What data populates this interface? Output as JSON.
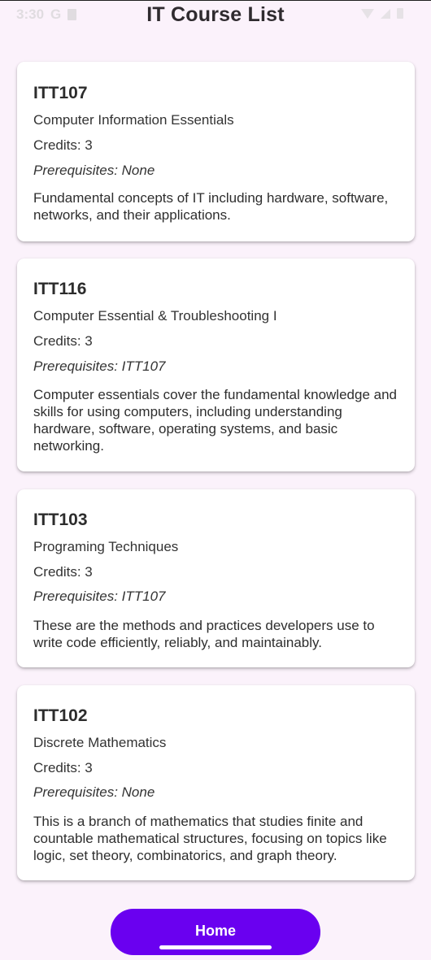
{
  "status_bar": {
    "time": "3:30",
    "indicator": "G"
  },
  "header": {
    "title": "IT Course List"
  },
  "courses": [
    {
      "code": "ITT107",
      "name": "Computer Information Essentials",
      "credits": "Credits: 3",
      "prerequisites": "Prerequisites: None",
      "description": "Fundamental concepts of IT including hardware, software, networks, and their applications."
    },
    {
      "code": "ITT116",
      "name": "Computer Essential & Troubleshooting I",
      "credits": "Credits: 3",
      "prerequisites": "Prerequisites: ITT107",
      "description": "Computer essentials cover the fundamental knowledge and skills for using computers, including understanding hardware, software, operating systems, and basic networking."
    },
    {
      "code": "ITT103",
      "name": "Programing Techniques",
      "credits": "Credits: 3",
      "prerequisites": "Prerequisites: ITT107",
      "description": "These are the methods and practices developers use to write code efficiently, reliably, and maintainably."
    },
    {
      "code": "ITT102",
      "name": "Discrete Mathematics",
      "credits": "Credits: 3",
      "prerequisites": "Prerequisites: None",
      "description": "This is a branch of mathematics that studies finite and countable mathematical structures, focusing on topics like logic, set theory, combinatorics, and graph theory."
    }
  ],
  "footer": {
    "home_label": "Home"
  },
  "colors": {
    "accent": "#6a00f0",
    "background": "#fbf2fb",
    "card": "#ffffff"
  }
}
